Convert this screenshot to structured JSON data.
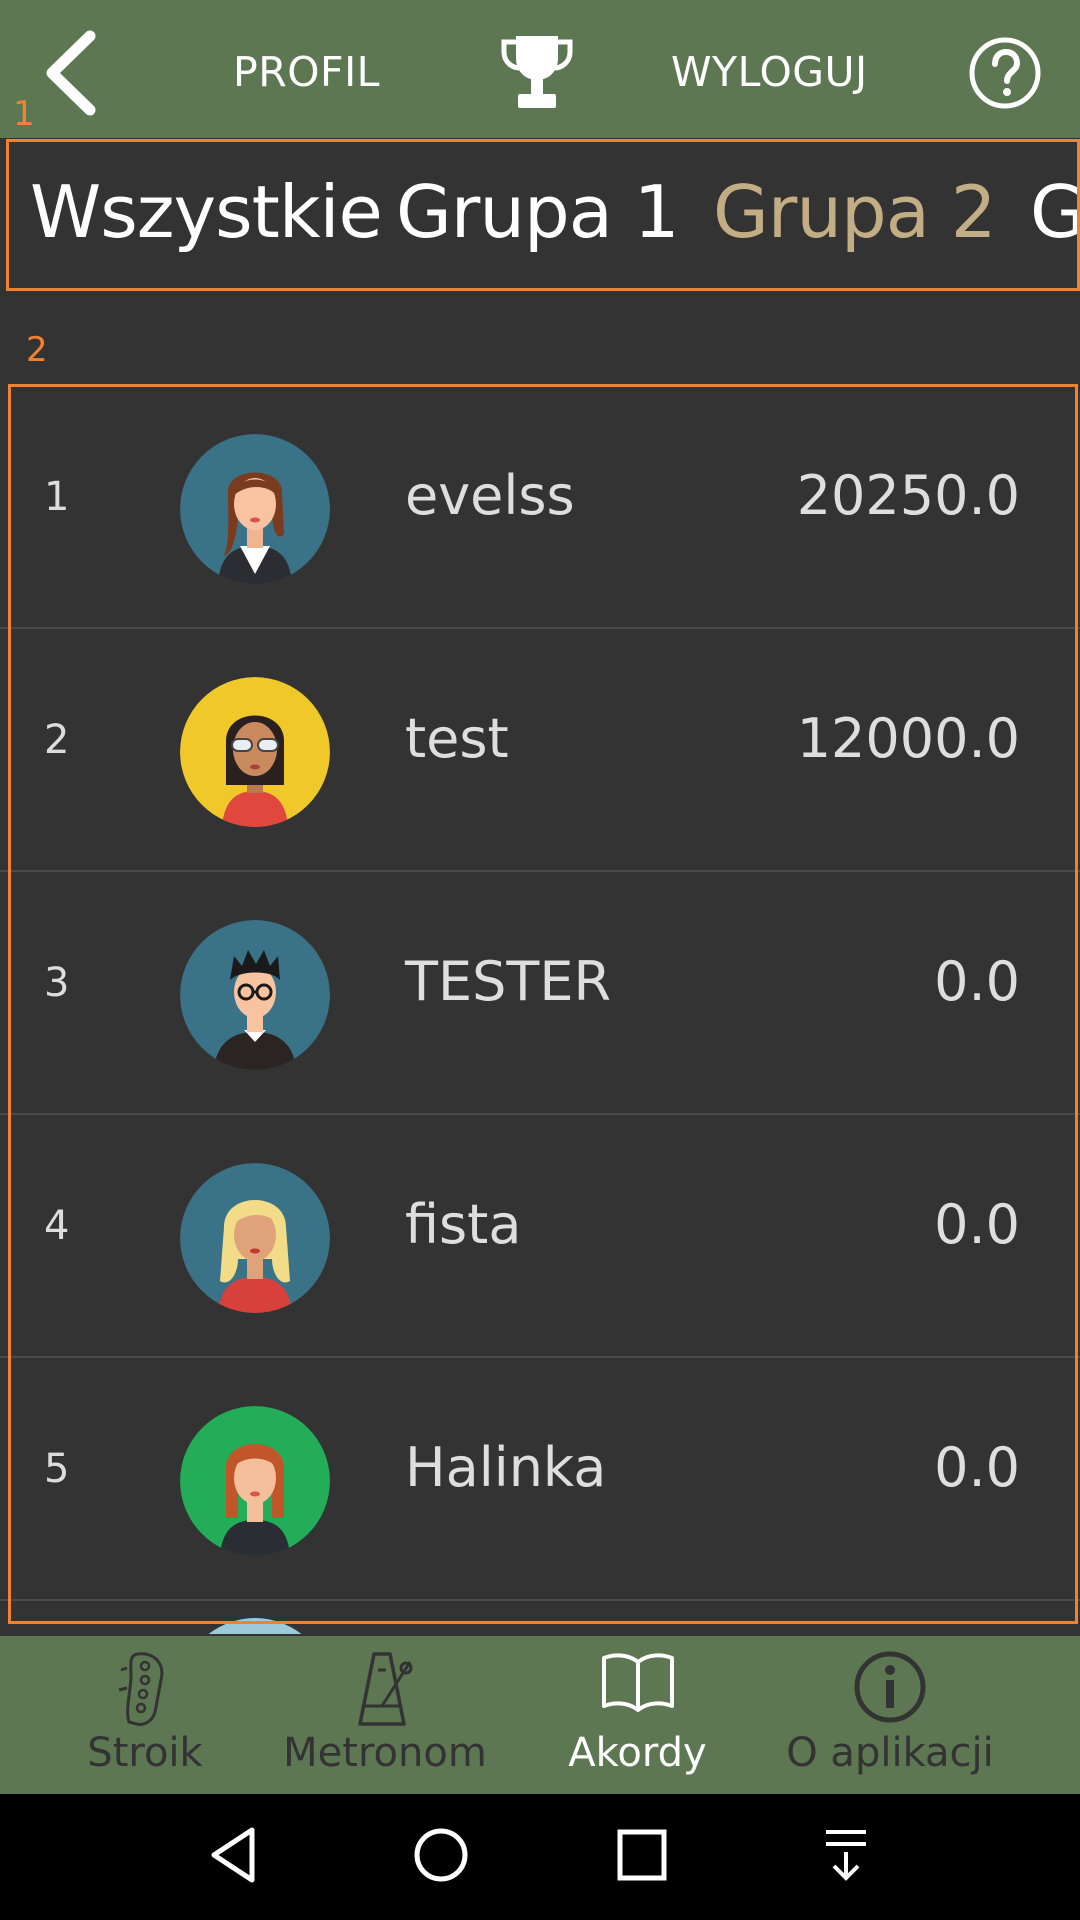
{
  "header": {
    "profile_label": "PROFIL",
    "logout_label": "WYLOGUJ"
  },
  "annotations": [
    "1",
    "2"
  ],
  "tabs": [
    {
      "label": "Wszystkie",
      "active": false
    },
    {
      "label": "Grupa 1",
      "active": false
    },
    {
      "label": "Grupa 2",
      "active": true
    },
    {
      "label": "G",
      "active": false
    }
  ],
  "leaderboard": [
    {
      "rank": "1",
      "name": "evelss",
      "score": "20250.0",
      "avatar_bg": "#3a7387"
    },
    {
      "rank": "2",
      "name": "test",
      "score": "12000.0",
      "avatar_bg": "#f0c829"
    },
    {
      "rank": "3",
      "name": "TESTER",
      "score": "0.0",
      "avatar_bg": "#3a7387"
    },
    {
      "rank": "4",
      "name": "fista",
      "score": "0.0",
      "avatar_bg": "#3a7387"
    },
    {
      "rank": "5",
      "name": "Halinka",
      "score": "0.0",
      "avatar_bg": "#24ad59"
    }
  ],
  "bottom_nav": [
    {
      "label": "Stroik",
      "icon": "guitar-headstock-icon",
      "active": false
    },
    {
      "label": "Metronom",
      "icon": "metronome-icon",
      "active": false
    },
    {
      "label": "Akordy",
      "icon": "book-icon",
      "active": true
    },
    {
      "label": "O aplikacji",
      "icon": "info-icon",
      "active": false
    }
  ],
  "colors": {
    "bar_green": "#5d7752",
    "background": "#333333",
    "active_tab": "#c2ad84",
    "annotation": "#f08232"
  }
}
